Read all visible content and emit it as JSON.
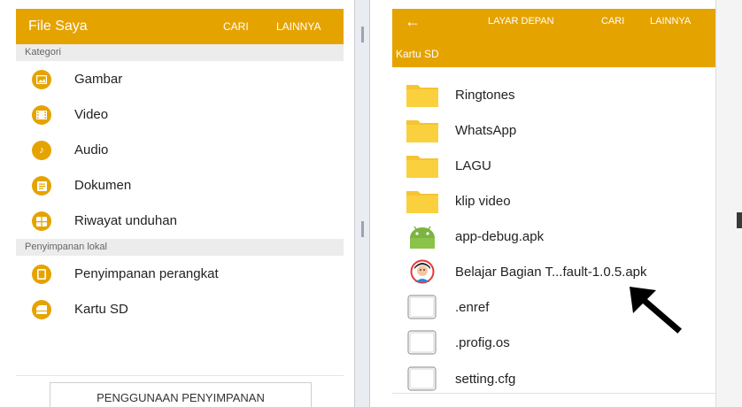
{
  "left_screen": {
    "title": "File Saya",
    "actions": [
      "CARI",
      "LAINNYA"
    ],
    "sections": {
      "kategori": "Kategori",
      "penyimpanan_lokal": "Penyimpanan lokal"
    },
    "categories": [
      {
        "label": "Gambar",
        "icon": "image-icon"
      },
      {
        "label": "Video",
        "icon": "video-icon"
      },
      {
        "label": "Audio",
        "icon": "music-note-icon"
      },
      {
        "label": "Dokumen",
        "icon": "document-icon"
      },
      {
        "label": "Riwayat unduhan",
        "icon": "download-history-icon"
      }
    ],
    "storage": [
      {
        "label": "Penyimpanan perangkat",
        "icon": "device-storage-icon"
      },
      {
        "label": "Kartu SD",
        "icon": "sd-card-icon"
      }
    ],
    "storage_usage_button": "PENGGUNAAN PENYIMPANAN"
  },
  "right_screen": {
    "actions": [
      "LAYAR DEPAN",
      "CARI",
      "LAINNYA"
    ],
    "breadcrumb": "Kartu SD",
    "files": [
      {
        "label": "Ringtones",
        "icon": "folder-icon"
      },
      {
        "label": "WhatsApp",
        "icon": "folder-icon"
      },
      {
        "label": "LAGU",
        "icon": "folder-icon"
      },
      {
        "label": "klip video",
        "icon": "folder-icon"
      },
      {
        "label": "app-debug.apk",
        "icon": "android-apk-icon"
      },
      {
        "label": "Belajar Bagian T...fault-1.0.5.apk",
        "icon": "app-avatar-icon"
      },
      {
        "label": ".enref",
        "icon": "file-icon"
      },
      {
        "label": ".profig.os",
        "icon": "file-icon"
      },
      {
        "label": "setting.cfg",
        "icon": "file-icon"
      }
    ]
  },
  "colors": {
    "accent": "#e5a300",
    "folder": "#f7c331",
    "android": "#7cb342",
    "section_bg": "#ececec"
  }
}
